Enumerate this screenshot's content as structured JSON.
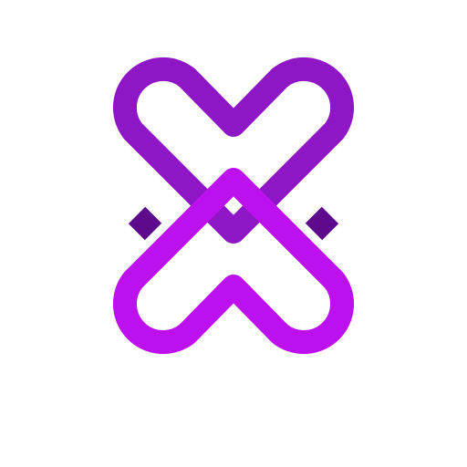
{
  "logo": {
    "icon": "interlocked-hearts-icon",
    "colors": {
      "background": "#ffffff",
      "top_heart": "#8e16c4",
      "top_heart_shadow": "#5d0a8c",
      "bottom_heart": "#bd10ef"
    }
  }
}
